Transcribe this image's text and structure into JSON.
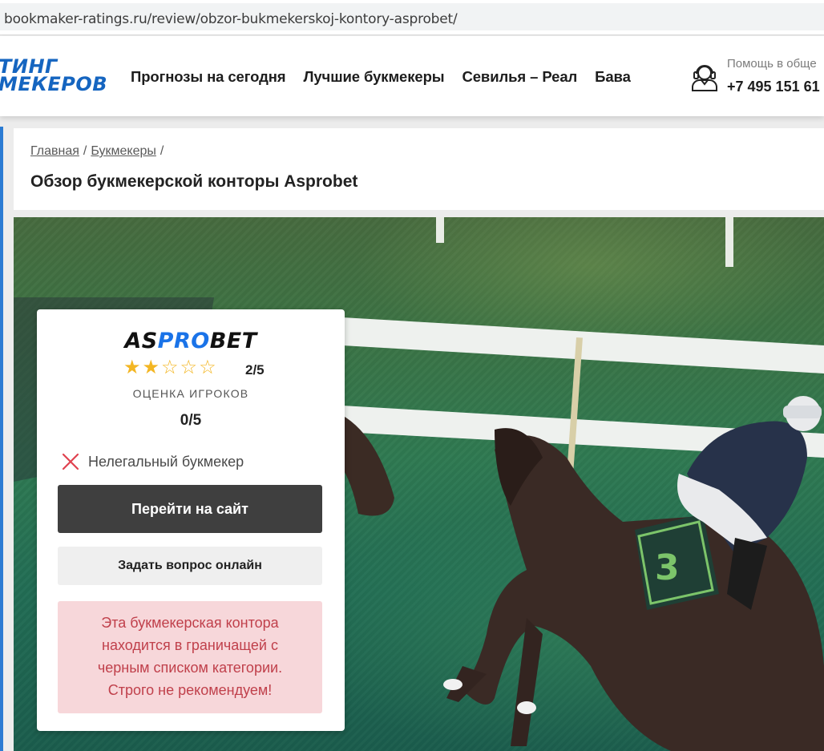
{
  "browser": {
    "url": "bookmaker-ratings.ru/review/obzor-bukmekerskoj-kontory-asprobet/"
  },
  "header": {
    "logo_line1": "ТИНГ",
    "logo_line2": "МЕКЕРОВ",
    "nav": [
      "Прогнозы на сегодня",
      "Лучшие букмекеры",
      "Севилья – Реал",
      "Бава"
    ],
    "help_title": "Помощь в обще",
    "help_phone": "+7 495 151 61"
  },
  "breadcrumbs": {
    "home": "Главная",
    "bookmakers": "Букмекеры",
    "separator": "/"
  },
  "page_title": "Обзор букмекерской конторы Asprobet",
  "card": {
    "brand_part1": "AS",
    "brand_part2": "PRO",
    "brand_part3": "BET",
    "rating_value": 2,
    "rating_max": 5,
    "rating_text": "2/5",
    "players_label": "ОЦЕНКА ИГРОКОВ",
    "players_score": "0/5",
    "illegal_text": "Нелегальный букмекер",
    "go_button": "Перейти на сайт",
    "ask_button": "Задать вопрос онлайн",
    "warning_lines": [
      "Эта букмекерская контора",
      "находится в граничащей с",
      "черным списком категории.",
      "Строго не рекомендуем!"
    ]
  },
  "hero": {
    "saddle_number": "3"
  },
  "colors": {
    "accent": "#1a73e8",
    "button_dark": "#3f3f3f",
    "warning_bg": "#f7d7da",
    "warning_text": "#c0404b",
    "star": "#f3b623"
  }
}
